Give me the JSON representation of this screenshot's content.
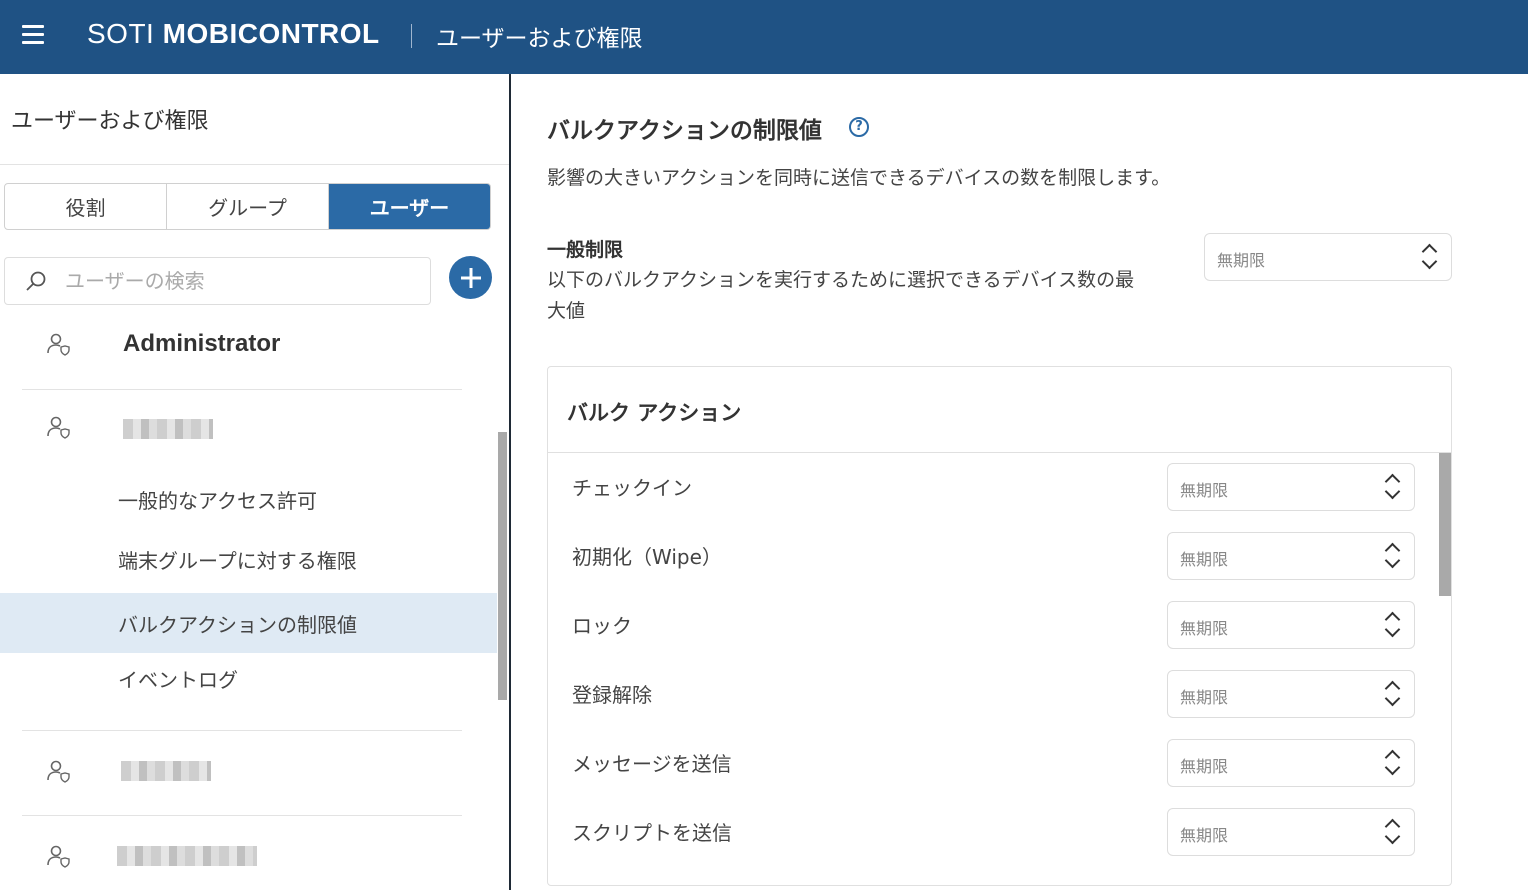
{
  "header": {
    "brand_light": "SOTI ",
    "brand_bold": "MOBICONTROL",
    "title": "ユーザーおよび権限"
  },
  "left": {
    "title": "ユーザーおよび権限",
    "tabs": [
      {
        "label": "役割",
        "active": false
      },
      {
        "label": "グループ",
        "active": false
      },
      {
        "label": "ユーザー",
        "active": true
      }
    ],
    "search": {
      "placeholder": "ユーザーの検索"
    },
    "users": [
      {
        "name": "Administrator"
      },
      {
        "name": ""
      },
      {
        "name": ""
      },
      {
        "name": ""
      }
    ],
    "submenu": [
      {
        "label": "一般的なアクセス許可",
        "selected": false
      },
      {
        "label": "端末グループに対する権限",
        "selected": false
      },
      {
        "label": "バルクアクションの制限値",
        "selected": true
      },
      {
        "label": "イベントログ",
        "selected": false
      }
    ]
  },
  "main": {
    "title": "バルクアクションの制限値",
    "help_icon": "?",
    "description": "影響の大きいアクションを同時に送信できるデバイスの数を制限します。",
    "general_limit": {
      "title": "一般制限",
      "description": "以下のバルクアクションを実行するために選択できるデバイス数の最大値",
      "value": "無期限"
    },
    "bulk_actions": {
      "title": "バルク アクション",
      "items": [
        {
          "label": "チェックイン",
          "value": "無期限"
        },
        {
          "label": "初期化（Wipe）",
          "value": "無期限"
        },
        {
          "label": "ロック",
          "value": "無期限"
        },
        {
          "label": "登録解除",
          "value": "無期限"
        },
        {
          "label": "メッセージを送信",
          "value": "無期限"
        },
        {
          "label": "スクリプトを送信",
          "value": "無期限"
        }
      ]
    }
  },
  "colors": {
    "header_bg": "#1f5284",
    "accent": "#2b6aa6",
    "selected_bg": "#dfeaf4"
  },
  "icons": {
    "menu": "hamburger-icon",
    "search": "search-icon",
    "add": "plus-icon",
    "user": "user-shield-icon",
    "help": "help-icon",
    "stepper": "chevron-up-down-icon"
  }
}
